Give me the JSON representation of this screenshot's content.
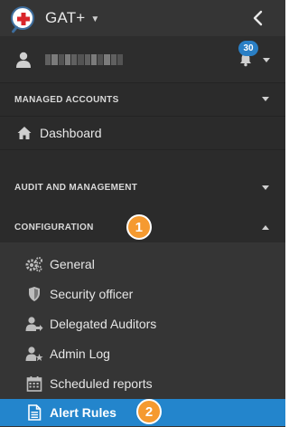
{
  "app": {
    "title": "GAT+"
  },
  "user": {
    "notification_count": "30"
  },
  "sections": {
    "managed_accounts": {
      "label": "MANAGED ACCOUNTS",
      "items": [
        {
          "label": "Dashboard",
          "icon": "home-icon"
        }
      ]
    },
    "audit": {
      "label": "AUDIT AND MANAGEMENT"
    },
    "configuration": {
      "label": "CONFIGURATION",
      "step": "1",
      "items": [
        {
          "label": "General",
          "icon": "gears-icon"
        },
        {
          "label": "Security officer",
          "icon": "shield-icon"
        },
        {
          "label": "Delegated Auditors",
          "icon": "user-share-icon"
        },
        {
          "label": "Admin Log",
          "icon": "user-star-icon"
        },
        {
          "label": "Scheduled reports",
          "icon": "calendar-icon"
        },
        {
          "label": "Alert Rules",
          "icon": "document-icon",
          "active": true,
          "step": "2"
        }
      ]
    }
  },
  "colors": {
    "sidebar_bg": "#2b2b2b",
    "submenu_bg": "#353535",
    "active_bg": "#2385cc",
    "step_badge": "#f59a30",
    "notification_badge": "#2a7fc5"
  }
}
